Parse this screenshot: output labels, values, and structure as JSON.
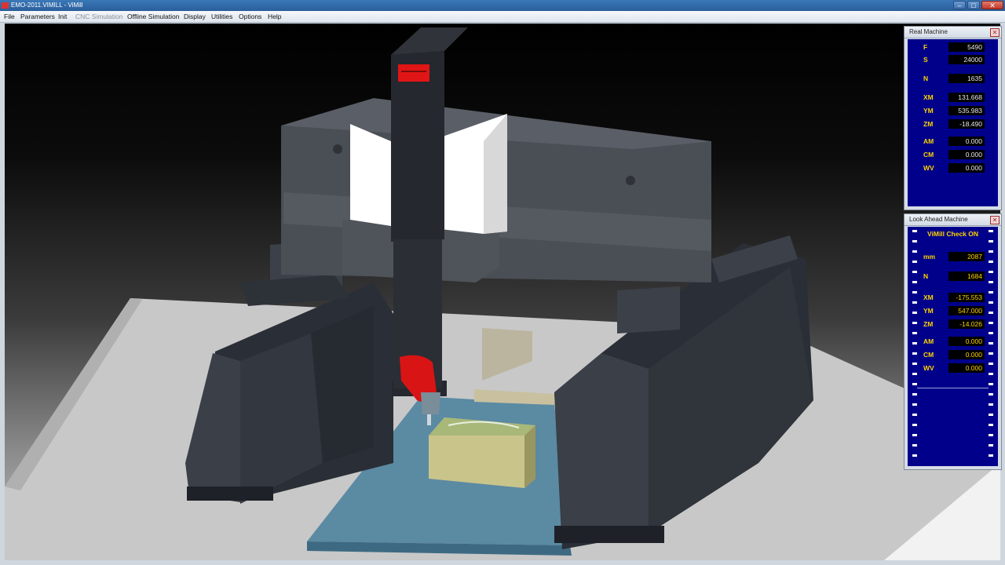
{
  "window": {
    "title": "EMO-2011.VIMILL - ViMill"
  },
  "menu": {
    "items": [
      "File",
      "Parameters",
      "Init",
      "CNC Simulation",
      "Offline Simulation",
      "Display",
      "Utilities",
      "Options",
      "Help"
    ]
  },
  "real_machine": {
    "title": "Real Machine",
    "rows": [
      {
        "label": "F",
        "value": "5490"
      },
      {
        "label": "S",
        "value": "24000"
      },
      {
        "label": "N",
        "value": "1635"
      },
      {
        "label": "XM",
        "value": "131.668"
      },
      {
        "label": "YM",
        "value": "535.983"
      },
      {
        "label": "ZM",
        "value": "-18.490"
      },
      {
        "label": "AM",
        "value": "0.000"
      },
      {
        "label": "CM",
        "value": "0.000"
      },
      {
        "label": "WV",
        "value": "0.000"
      }
    ]
  },
  "look_ahead": {
    "title": "Look Ahead Machine",
    "check_label": "ViMill Check ON",
    "rows": [
      {
        "label": "mm",
        "value": "2087"
      },
      {
        "label": "N",
        "value": "1684"
      },
      {
        "label": "XM",
        "value": "-175.553"
      },
      {
        "label": "YM",
        "value": "547.000"
      },
      {
        "label": "ZM",
        "value": "-14.026"
      },
      {
        "label": "AM",
        "value": "0.000"
      },
      {
        "label": "CM",
        "value": "0.000"
      },
      {
        "label": "WV",
        "value": "0.000"
      }
    ]
  },
  "colors": {
    "panel_bg": "#00008b",
    "value_text": "#ffd400",
    "head_red": "#e01515",
    "workpiece": "#c9c48a",
    "table": "#5f8fa8"
  }
}
